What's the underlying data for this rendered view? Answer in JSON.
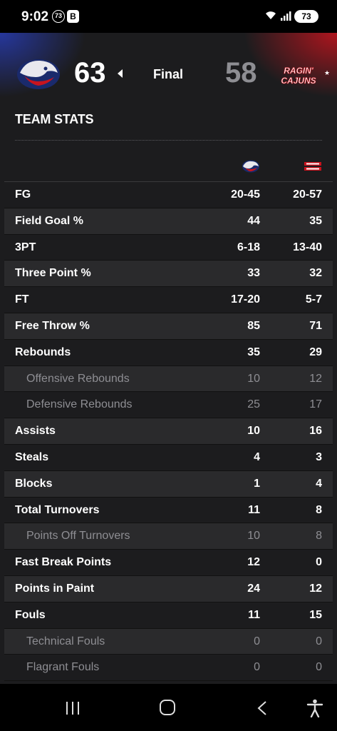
{
  "status_bar": {
    "time": "9:02",
    "notification_badge": "73",
    "b_icon": "B",
    "battery": "73"
  },
  "game": {
    "home_score": "63",
    "status": "Final",
    "away_score": "58",
    "away_logo_text_1": "RAGIN'",
    "away_logo_text_2": "CAJUNS",
    "away_rank_marker": "★"
  },
  "team_stats": {
    "title": "TEAM STATS",
    "rows": [
      {
        "label": "FG",
        "a": "20-45",
        "b": "20-57",
        "sub": false
      },
      {
        "label": "Field Goal %",
        "a": "44",
        "b": "35",
        "sub": false
      },
      {
        "label": "3PT",
        "a": "6-18",
        "b": "13-40",
        "sub": false
      },
      {
        "label": "Three Point %",
        "a": "33",
        "b": "32",
        "sub": false
      },
      {
        "label": "FT",
        "a": "17-20",
        "b": "5-7",
        "sub": false
      },
      {
        "label": "Free Throw %",
        "a": "85",
        "b": "71",
        "sub": false
      },
      {
        "label": "Rebounds",
        "a": "35",
        "b": "29",
        "sub": false
      },
      {
        "label": "Offensive Rebounds",
        "a": "10",
        "b": "12",
        "sub": true
      },
      {
        "label": "Defensive Rebounds",
        "a": "25",
        "b": "17",
        "sub": true
      },
      {
        "label": "Assists",
        "a": "10",
        "b": "16",
        "sub": false
      },
      {
        "label": "Steals",
        "a": "4",
        "b": "3",
        "sub": false
      },
      {
        "label": "Blocks",
        "a": "1",
        "b": "4",
        "sub": false
      },
      {
        "label": "Total Turnovers",
        "a": "11",
        "b": "8",
        "sub": false
      },
      {
        "label": "Points Off Turnovers",
        "a": "10",
        "b": "8",
        "sub": true
      },
      {
        "label": "Fast Break Points",
        "a": "12",
        "b": "0",
        "sub": false
      },
      {
        "label": "Points in Paint",
        "a": "24",
        "b": "12",
        "sub": false
      },
      {
        "label": "Fouls",
        "a": "11",
        "b": "15",
        "sub": false
      },
      {
        "label": "Technical Fouls",
        "a": "0",
        "b": "0",
        "sub": true
      },
      {
        "label": "Flagrant Fouls",
        "a": "0",
        "b": "0",
        "sub": true
      }
    ]
  },
  "icons": {
    "home_team_logo": "jaguar-logo-icon",
    "away_team_logo": "ragin-cajuns-logo-icon",
    "winner_arrow": "triangle-left-icon",
    "nav_recents": "recents-icon",
    "nav_home": "home-icon",
    "nav_back": "back-icon",
    "nav_accessibility": "accessibility-icon"
  },
  "colors": {
    "background": "#1c1c1e",
    "row_alt": "#2a2a2c",
    "home_accent": "#2c3e9e",
    "away_accent": "#c8141e",
    "loser_score": "#8e8e93",
    "sub_text": "#8e8e93"
  }
}
